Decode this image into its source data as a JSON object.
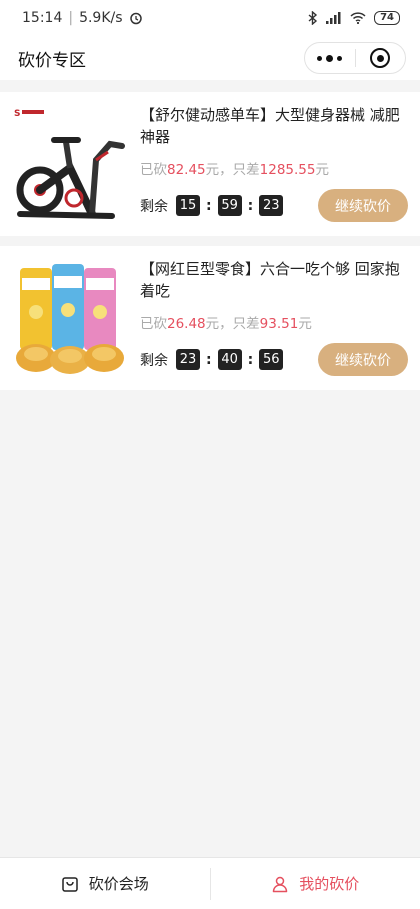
{
  "statusbar": {
    "time": "15:14",
    "speed": "5.9K/s",
    "battery": "74"
  },
  "nav": {
    "title": "砍价专区"
  },
  "products": [
    {
      "name": "【舒尔健动感单车】大型健身器械 减肥神器",
      "cut_prefix": "已砍",
      "cut_amount": "82.45",
      "cut_mid": "元，只差",
      "remain_amount": "1285.55",
      "remain_suffix": "元",
      "countdown_label": "剩余",
      "hh": "15",
      "mm": "59",
      "ss": "23",
      "button": "继续砍价"
    },
    {
      "name": "【网红巨型零食】六合一吃个够 回家抱着吃",
      "cut_prefix": "已砍",
      "cut_amount": "26.48",
      "cut_mid": "元，只差",
      "remain_amount": "93.51",
      "remain_suffix": "元",
      "countdown_label": "剩余",
      "hh": "23",
      "mm": "40",
      "ss": "56",
      "button": "继续砍价"
    }
  ],
  "tabbar": {
    "tab1": "砍价会场",
    "tab2": "我的砍价"
  },
  "colors": {
    "accent": "#e5505f",
    "button": "#d8b07f",
    "timer": "#222222"
  }
}
